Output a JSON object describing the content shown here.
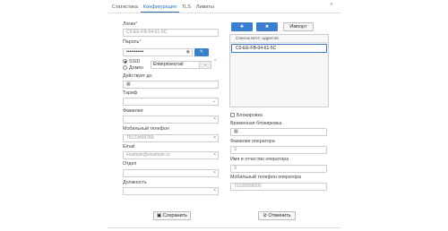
{
  "tabs": [
    {
      "label": "Статистика",
      "active": false
    },
    {
      "label": "Конфигурация",
      "active": true
    },
    {
      "label": "TLS",
      "active": false
    },
    {
      "label": "Лимиты",
      "active": false
    }
  ],
  "close_glyph": "×",
  "form": {
    "login": {
      "label": "Логин",
      "required": "*",
      "placeholder": "C0-EE-FB-04-61-5C"
    },
    "password": {
      "label": "Пароль",
      "required": "*",
      "value": "•••••••••••"
    },
    "ssid": {
      "label": "SSID",
      "checked": true
    },
    "domain": {
      "label": "Домен",
      "checked": false,
      "value": "Enterprisecrost",
      "required": "*"
    },
    "valid_until": {
      "label": "Действует до"
    },
    "tariff": {
      "label": "Тариф"
    },
    "surname": {
      "label": "Фамилия"
    },
    "mobile": {
      "label": "Мобильный телефон",
      "placeholder": "79123456789"
    },
    "email": {
      "label": "Email",
      "placeholder": "example@example.ru"
    },
    "department": {
      "label": "Отдел"
    },
    "position": {
      "label": "Должность"
    }
  },
  "mac": {
    "import_label": "Импорт",
    "list_header": "Список MAC адресов",
    "items": [
      "C0-EE-FB-04-61-5C"
    ]
  },
  "lock": {
    "checkbox_label": "Блокировка",
    "temp_lock_label": "Временная блокировка",
    "op_surname_label": "Фамилия оператора",
    "op_surname_placeholder": "S",
    "op_name_label": "Имя и отчество оператора",
    "op_name_placeholder": "S",
    "op_phone_label": "Мобильный телефон оператора",
    "op_phone_placeholder": "79100000000"
  },
  "buttons": {
    "save": "Сохранить",
    "cancel": "Отменить"
  },
  "icons": {
    "calendar": "▦",
    "key": "✎",
    "eye": "◉",
    "chevron": "⌄",
    "save": "▣",
    "cancel": "⊘",
    "add": "✚",
    "remove": "✖"
  },
  "colors": {
    "accent": "#3a7ed0",
    "required": "#d9534f"
  }
}
